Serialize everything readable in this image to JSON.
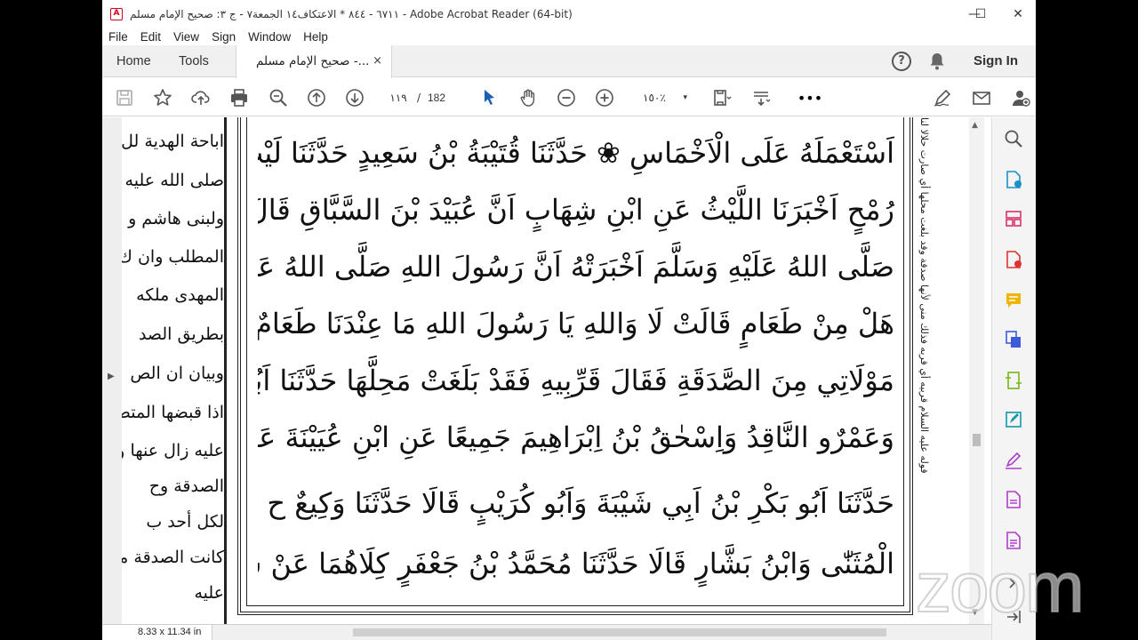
{
  "window": {
    "title": "٦٧١١ - ٨٤٤ * الاعتكاف١٤ الجمعة٧ - ج ٣: صحيح الإمام مسلم - Adobe Acrobat Reader (64-bit)",
    "app_icon": "acrobat-icon",
    "controls": {
      "minimize": "—",
      "maximize": "☐",
      "close": "✕"
    }
  },
  "menu": [
    "File",
    "Edit",
    "View",
    "Sign",
    "Window",
    "Help"
  ],
  "tabs": {
    "home": "Home",
    "tools": "Tools",
    "document": "صحيح الإمام مسلم -...",
    "close": "×"
  },
  "header_right": {
    "help": "?",
    "signin": "Sign In"
  },
  "toolbar": {
    "page_current": "١١٩",
    "page_sep": "/",
    "page_total": "182",
    "zoom": "١٥٠٪",
    "zoom_caret": "▾",
    "more": "•••"
  },
  "document": {
    "main_lines": [
      "اَسْتَعْمَلَهُ عَلَى الْاَخْمَاسِ ❀ حَدَّثَنَا قُتَيْبَةُ بْنُ سَعِيدٍ حَدَّثَنَا لَيْثٌ ح وَحَدَّثَنَا مُحَمَّدُ بْنُ",
      "رُمْحٍ اَخْبَرَنَا اللَّيْثُ عَنِ ابْنِ شِهَابٍ اَنَّ عُبَيْدَ بْنَ السَّبَّاقِ قَالَ اِنَّ جُوَيْرِيَةَ زَوْجَ النَّبِيِّ",
      "صَلَّى اللهُ عَلَيْهِ وَسَلَّمَ اَخْبَرَتْهُ اَنَّ رَسُولَ اللهِ صَلَّى اللهُ عَلَيْهِ وَسَلَّمَ دَخَلَ عَلَيْهَا فَقَالَ",
      "هَلْ مِنْ طَعَامٍ قَالَتْ لَا وَاللهِ يَا رَسُولَ اللهِ مَا عِنْدَنَا طَعَامٌ اِلَّا عَظْمٌ مِنْ شَاةٍ اُعْطِيَتْهُ",
      "مَوْلَاتِي مِنَ الصَّدَقَةِ فَقَالَ قَرِّبِيهِ فَقَدْ بَلَغَتْ مَحِلَّهَا حَدَّثَنَا اَبُو بَكْرِ بْنُ اَبِي شَيْبَةَ",
      "وَعَمْرٌو النَّاقِدُ وَاِسْحٰقُ بْنُ اِبْرَاهِيمَ جَمِيعًا عَنِ ابْنِ عُيَيْنَةَ عَنِ الزُّهْرِيِّ بِهٰذَا الْاِسْنَادِ نَحْوَهُ",
      "حَدَّثَنَا اَبُو بَكْرِ بْنُ اَبِي شَيْبَةَ وَاَبُو كُرَيْبٍ قَالَا حَدَّثَنَا وَكِيعٌ ح وَحَدَّثَنَا مُحَمَّدُ بْنُ",
      "الْمُثَنّٰى وَابْنُ بَشَّارٍ قَالَا حَدَّثَنَا مُحَمَّدُ بْنُ جَعْفَرٍ كِلَاهُمَا عَنْ شُعْبَةَ عَنْ قَتَادَةَ عَنْ اَنَسٍ"
    ],
    "left_page_lines": [
      "اباحة الهدية لل",
      "صلى الله عليه و",
      "ولبنى هاشم و",
      "المطلب وان ك",
      "المهدى ملكه",
      "بطريق الصد",
      "وبيان ان الص",
      "اذا قبضها المتص",
      "عليه زال عنها و",
      "الصدقة وح",
      "لكل أحد ب",
      "كانت الصدقة مح",
      "عليه"
    ],
    "margin_note": "قوله عليه السلام قربيه أي قربه فذلك منى لأنها صدقة وقد بلغت محلها أي صارت حلالا لنا"
  },
  "status": {
    "page_size": "8.33 x 11.34 in"
  },
  "watermark": "zoom"
}
